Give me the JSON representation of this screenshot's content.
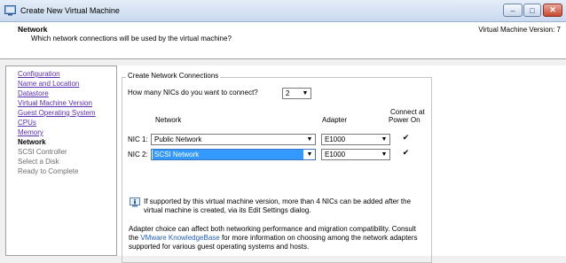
{
  "window": {
    "title": "Create New Virtual Machine",
    "controls": {
      "minimize": "–",
      "maximize": "□",
      "close": "✕"
    }
  },
  "header": {
    "title": "Network",
    "subtitle": "Which network connections will be used by the virtual machine?",
    "version": "Virtual Machine Version: 7"
  },
  "sidebar": {
    "items": [
      {
        "label": "Configuration",
        "state": "link"
      },
      {
        "label": "Name and Location",
        "state": "link"
      },
      {
        "label": "Datastore",
        "state": "link"
      },
      {
        "label": "Virtual Machine Version",
        "state": "link"
      },
      {
        "label": "Guest Operating System",
        "state": "link"
      },
      {
        "label": "CPUs",
        "state": "link"
      },
      {
        "label": "Memory",
        "state": "link"
      },
      {
        "label": "Network",
        "state": "current"
      },
      {
        "label": "SCSI Controller",
        "state": "future"
      },
      {
        "label": "Select a Disk",
        "state": "future"
      },
      {
        "label": "Ready to Complete",
        "state": "future"
      }
    ]
  },
  "main": {
    "group_title": "Create Network Connections",
    "nic_count_question": "How many NICs do you want to connect?",
    "nic_count_value": "2",
    "col_network": "Network",
    "col_adapter": "Adapter",
    "col_connect_line1": "Connect at",
    "col_connect_line2": "Power On",
    "nics": [
      {
        "label": "NIC 1:",
        "network": "Public Network",
        "adapter": "E1000",
        "connect": true,
        "selected": false
      },
      {
        "label": "NIC 2:",
        "network": "SCSI Network",
        "adapter": "E1000",
        "connect": true,
        "selected": true
      }
    ],
    "info_line1": "If supported by this virtual machine version, more than 4 NICs can be added after the",
    "info_line2": "virtual machine is created, via its Edit Settings dialog.",
    "note_line1": "Adapter choice can affect both networking performance and migration compatibility. Consult",
    "note_line2_prefix": "the ",
    "note_link": "VMware KnowledgeBase",
    "note_line2_suffix": " for more information on choosing among the network adapters",
    "note_line3": "supported for various guest operating systems and hosts."
  },
  "icons": {
    "app": "vm-icon",
    "info": "info-icon",
    "dropdown": "chevron-down-icon",
    "check": "checkmark-icon"
  },
  "colors": {
    "link": "#5a2db5",
    "kb_link": "#1f5fbf",
    "selection": "#3399ff"
  }
}
